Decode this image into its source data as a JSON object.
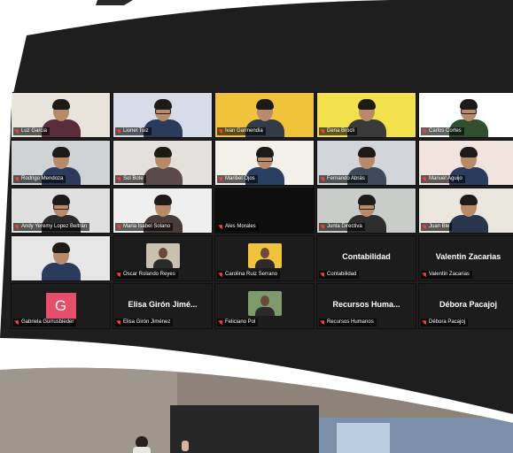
{
  "colors": {
    "band": "#1e1e1e",
    "muted_icon": "#ff3b3b",
    "avatar": "#e74e6b"
  },
  "meeting": {
    "participants": [
      {
        "name": "Luz Garcia",
        "kind": "video"
      },
      {
        "name": "Lionel Tuiz",
        "kind": "video"
      },
      {
        "name": "Ivan Garmendia",
        "kind": "video"
      },
      {
        "name": "Dena Brocli",
        "kind": "video"
      },
      {
        "name": "Carlos Cortes",
        "kind": "video"
      },
      {
        "name": "Rodrigo Mendoza",
        "kind": "video"
      },
      {
        "name": "Sol Bote",
        "kind": "video"
      },
      {
        "name": "Maribel Ojos",
        "kind": "video"
      },
      {
        "name": "Fernando Abrás",
        "kind": "video"
      },
      {
        "name": "Manuel Aguijo",
        "kind": "video"
      },
      {
        "name": "Andy Yeremy Lopez Beltrán",
        "kind": "video"
      },
      {
        "name": "Maria Isabel Solano",
        "kind": "video"
      },
      {
        "name": "Ales Morales",
        "kind": "video"
      },
      {
        "name": "Junta Directiva",
        "kind": "video"
      },
      {
        "name": "Juan Ble",
        "kind": "video"
      },
      {
        "name": "",
        "kind": "video"
      },
      {
        "name": "Oscar Rolando Reyes",
        "kind": "thumb"
      },
      {
        "name": "Carolina Ruiz Serrano",
        "kind": "thumb"
      },
      {
        "name": "Contabilidad",
        "kind": "name",
        "display": "Contabilidad"
      },
      {
        "name": "Valentin Zacarias",
        "kind": "name",
        "display": "Valentin Zacarias"
      },
      {
        "name": "Gabriela Gurrusbieder",
        "kind": "avatar",
        "initial": "G"
      },
      {
        "name": "Elisa Girón Jiménez",
        "kind": "name",
        "display": "Elisa Girón Jimé..."
      },
      {
        "name": "Feliciano Pol",
        "kind": "thumb"
      },
      {
        "name": "Recursos Humanos",
        "kind": "name",
        "display": "Recursos Huma..."
      },
      {
        "name": "Débora Pacajoj",
        "kind": "name",
        "display": "Débora Pacajoj"
      }
    ]
  }
}
